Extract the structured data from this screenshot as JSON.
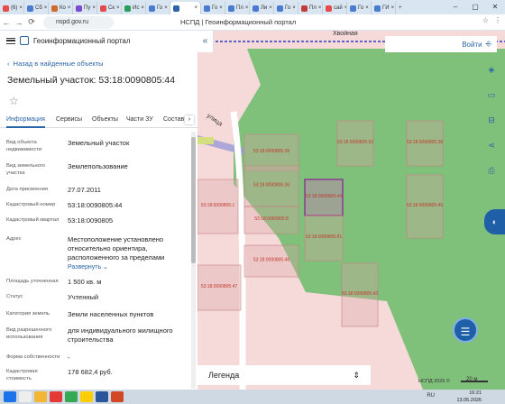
{
  "browser": {
    "tabs": [
      {
        "label": "(6)",
        "color": "#e54b4b"
      },
      {
        "label": "Сб",
        "color": "#4a7bd0"
      },
      {
        "label": "Ко",
        "color": "#d06a2a"
      },
      {
        "label": "Пу",
        "color": "#7a4ad0"
      },
      {
        "label": "Ск",
        "color": "#e54b4b"
      },
      {
        "label": "Ис",
        "color": "#2a9d5a"
      },
      {
        "label": "Го",
        "color": "#4a7bd0"
      },
      {
        "label": "",
        "color": "#2a64a8",
        "active": true
      },
      {
        "label": "Го",
        "color": "#4a7bd0"
      },
      {
        "label": "Пл",
        "color": "#4a7bd0"
      },
      {
        "label": "Ли",
        "color": "#4a7bd0"
      },
      {
        "label": "Го",
        "color": "#4a7bd0"
      },
      {
        "label": "Пл",
        "color": "#c23a3a"
      },
      {
        "label": "сай",
        "color": "#e54b4b"
      },
      {
        "label": "Го",
        "color": "#4a7bd0"
      },
      {
        "label": "ГИ",
        "color": "#4a7bd0"
      }
    ],
    "new_tab": "+",
    "url": "nspd.gov.ru",
    "page_title": "НСПД | Геоинформационный портал"
  },
  "header": {
    "title": "Геоинформационный портал"
  },
  "back_link": "Назад в найденные объекты",
  "object_title": "Земельный участок: 53:18:0090805:44",
  "tabs": [
    {
      "label": "Информация",
      "active": true
    },
    {
      "label": "Сервисы"
    },
    {
      "label": "Объекты"
    },
    {
      "label": "Части ЗУ"
    },
    {
      "label": "Состав"
    }
  ],
  "info": [
    {
      "label": "Вид объекта недвижимости",
      "value": "Земельный участок"
    },
    {
      "label": "Вид земельного участка",
      "value": "Землепользование"
    },
    {
      "label": "Дата присвоения",
      "value": "27.07.2011"
    },
    {
      "label": "Кадастровый номер",
      "value": "53:18:0090805:44"
    },
    {
      "label": "Кадастровый квартал",
      "value": "53:18:0090805"
    },
    {
      "label": "Адрес",
      "value": "Местоположение установлено относительно ориентира, расположенного за пределами",
      "link": "Развернуть"
    },
    {
      "label": "Площадь уточненная",
      "value": "1 500 кв. м"
    },
    {
      "label": "Статус",
      "value": "Учтенный"
    },
    {
      "label": "Категория земель",
      "value": "Земли населенных пунктов"
    },
    {
      "label": "Вид разрешенного использования",
      "value": "для индивидуального жилищного строительства"
    },
    {
      "label": "Форма собственности",
      "value": "-"
    },
    {
      "label": "Кадастровая стоимость",
      "value": "178 682,4 руб."
    }
  ],
  "map": {
    "login": "Войти",
    "street_label_1": "Хвойная",
    "street_label_2": "улица",
    "parcel_labels": [
      "53:18:0090805:39",
      "53:18:0090805:53",
      "53:18:0090805:38",
      "53:18:0090805:36",
      "53:18:0090805:44",
      "53:18:0090805:45",
      "53:18:0090805:8",
      "53:18:0090805:81",
      "53:18:0090805:1",
      "53:18:0090805:46",
      "53:18:0090805:43",
      "53:18:0090805:47"
    ],
    "legend": "Легенда",
    "copyright": "НСПД 2026 ©",
    "scale": "20 м",
    "forest_color": "#7fc07a",
    "parcel_color": "#f6dada",
    "selected_color": "#8a3d8f"
  },
  "taskbar": {
    "lang": "RU",
    "time": "16:21",
    "date": "13.05.2026"
  }
}
